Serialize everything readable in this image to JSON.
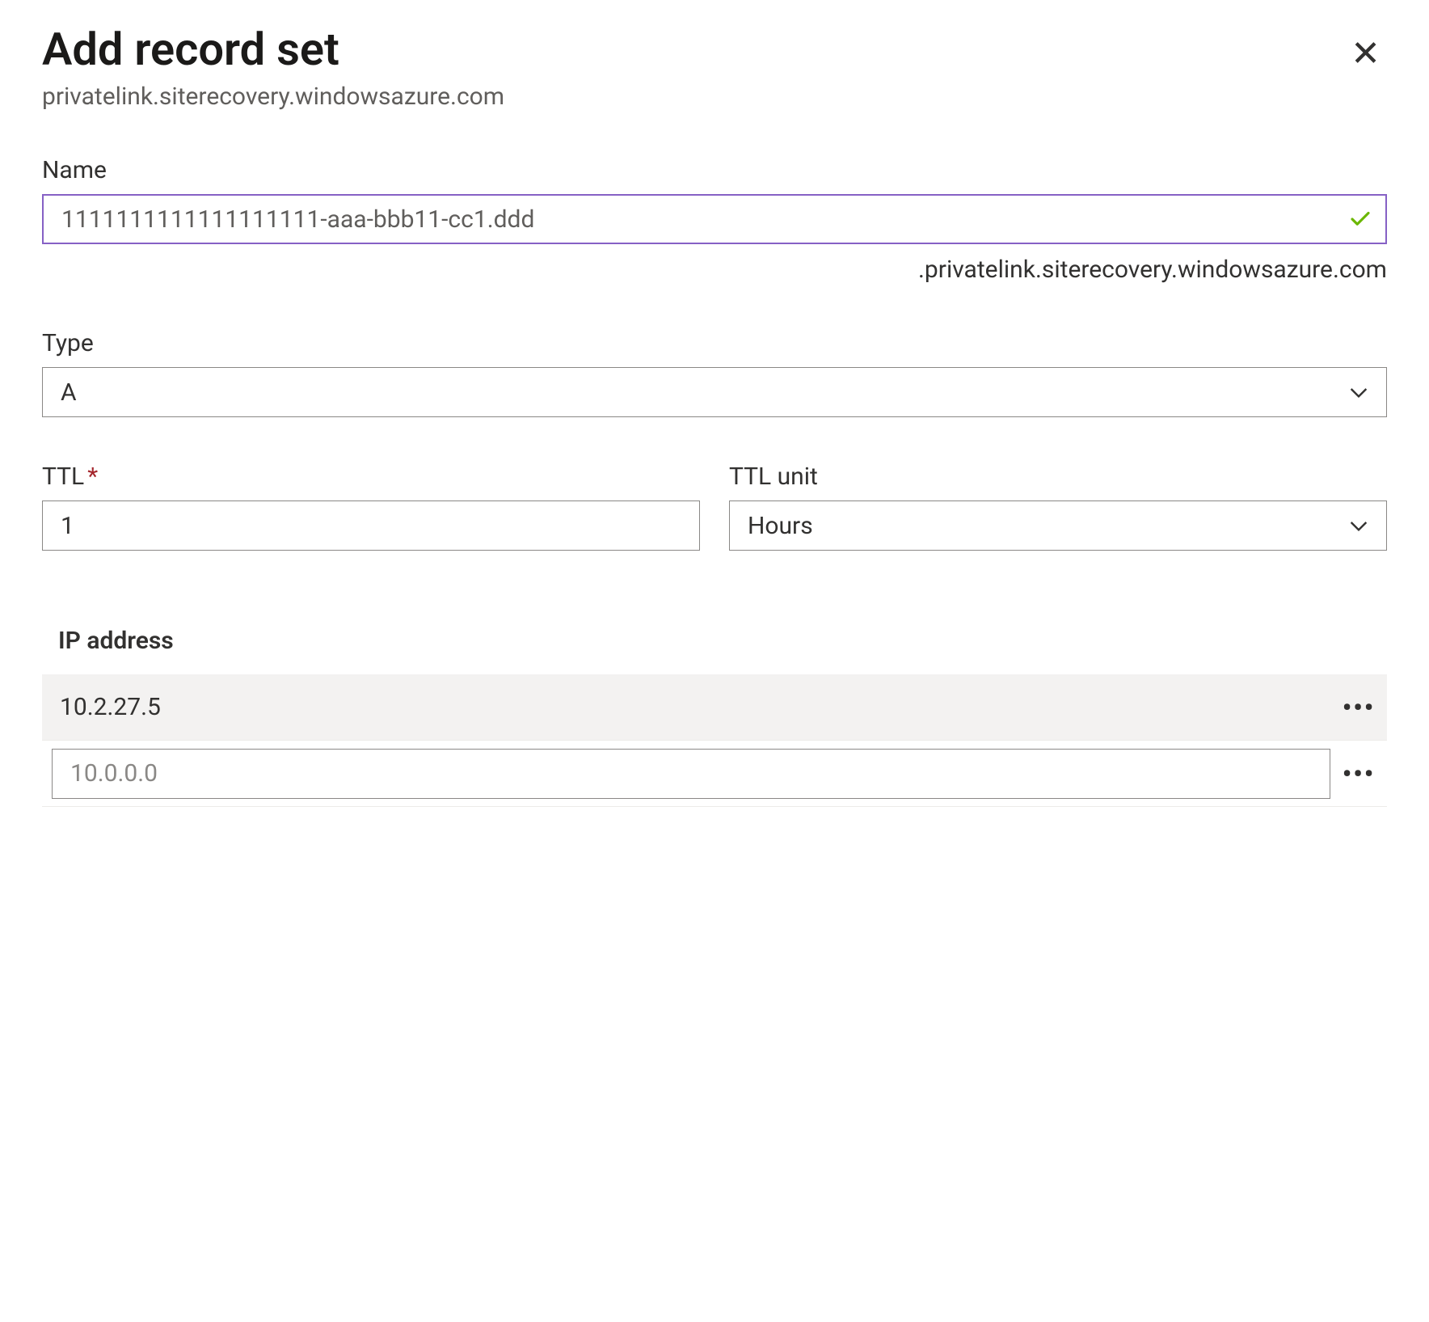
{
  "header": {
    "title": "Add record set",
    "subtitle": "privatelink.siterecovery.windowsazure.com"
  },
  "name": {
    "label": "Name",
    "value": "1111111111111111111-aaa-bbb11-cc1.ddd",
    "suffix": ".privatelink.siterecovery.windowsazure.com"
  },
  "type": {
    "label": "Type",
    "value": "A"
  },
  "ttl": {
    "label": "TTL",
    "value": "1"
  },
  "ttl_unit": {
    "label": "TTL unit",
    "value": "Hours"
  },
  "ip": {
    "label": "IP address",
    "existing": "10.2.27.5",
    "placeholder": "10.0.0.0"
  }
}
